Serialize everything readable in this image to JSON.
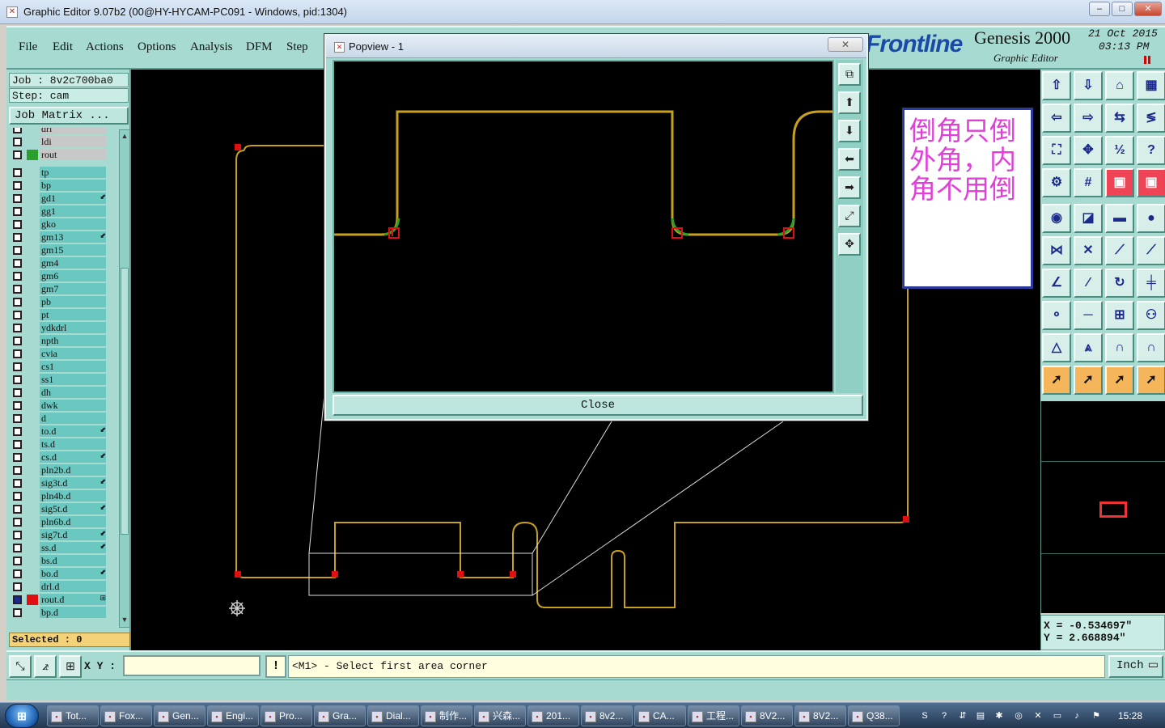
{
  "window": {
    "title": "Graphic Editor 9.07b2 (00@HY-HYCAM-PC091 - Windows, pid:1304)",
    "min": "‒",
    "max": "□",
    "close": "✕"
  },
  "menu": {
    "items": [
      "File",
      "Edit",
      "Actions",
      "Options",
      "Analysis",
      "DFM",
      "Step"
    ]
  },
  "brand": {
    "logo": "Frontline",
    "product": "Genesis 2000",
    "subtitle": "Graphic Editor",
    "date": "21 Oct 2015",
    "time": "03:13 PM",
    "logo_color": "#1a4aa8"
  },
  "job": {
    "job_line": "Job : 8v2c700ba0",
    "step_line": "Step: cam",
    "matrix_button": "Job Matrix ..."
  },
  "layers": [
    {
      "name": "drl",
      "color": "",
      "board": true,
      "flag": ""
    },
    {
      "name": "ldi",
      "color": "",
      "board": true,
      "flag": ""
    },
    {
      "name": "rout",
      "color": "#2aa02a",
      "board": true,
      "flag": ""
    },
    {
      "name": "tp",
      "color": "",
      "board": false,
      "flag": ""
    },
    {
      "name": "bp",
      "color": "",
      "board": false,
      "flag": ""
    },
    {
      "name": "gd1",
      "color": "",
      "board": false,
      "flag": "⬋"
    },
    {
      "name": "gg1",
      "color": "",
      "board": false,
      "flag": ""
    },
    {
      "name": "gko",
      "color": "",
      "board": false,
      "flag": ""
    },
    {
      "name": "gm13",
      "color": "",
      "board": false,
      "flag": "⬋"
    },
    {
      "name": "gm15",
      "color": "",
      "board": false,
      "flag": ""
    },
    {
      "name": "gm4",
      "color": "",
      "board": false,
      "flag": ""
    },
    {
      "name": "gm6",
      "color": "",
      "board": false,
      "flag": ""
    },
    {
      "name": "gm7",
      "color": "",
      "board": false,
      "flag": ""
    },
    {
      "name": "pb",
      "color": "",
      "board": false,
      "flag": ""
    },
    {
      "name": "pt",
      "color": "",
      "board": false,
      "flag": ""
    },
    {
      "name": "ydkdrl",
      "color": "",
      "board": false,
      "flag": ""
    },
    {
      "name": "npth",
      "color": "",
      "board": false,
      "flag": ""
    },
    {
      "name": "cvia",
      "color": "",
      "board": false,
      "flag": ""
    },
    {
      "name": "cs1",
      "color": "",
      "board": false,
      "flag": ""
    },
    {
      "name": "ss1",
      "color": "",
      "board": false,
      "flag": ""
    },
    {
      "name": "dh",
      "color": "",
      "board": false,
      "flag": ""
    },
    {
      "name": "dwk",
      "color": "",
      "board": false,
      "flag": ""
    },
    {
      "name": "d",
      "color": "",
      "board": false,
      "flag": ""
    },
    {
      "name": "to.d",
      "color": "",
      "board": false,
      "flag": "⬋"
    },
    {
      "name": "ts.d",
      "color": "",
      "board": false,
      "flag": ""
    },
    {
      "name": "cs.d",
      "color": "",
      "board": false,
      "flag": "⬋"
    },
    {
      "name": "pln2b.d",
      "color": "",
      "board": false,
      "flag": ""
    },
    {
      "name": "sig3t.d",
      "color": "",
      "board": false,
      "flag": "⬋"
    },
    {
      "name": "pln4b.d",
      "color": "",
      "board": false,
      "flag": ""
    },
    {
      "name": "sig5t.d",
      "color": "",
      "board": false,
      "flag": "⬋"
    },
    {
      "name": "pln6b.d",
      "color": "",
      "board": false,
      "flag": ""
    },
    {
      "name": "sig7t.d",
      "color": "",
      "board": false,
      "flag": "⬋"
    },
    {
      "name": "ss.d",
      "color": "",
      "board": false,
      "flag": "⬋"
    },
    {
      "name": "bs.d",
      "color": "",
      "board": false,
      "flag": ""
    },
    {
      "name": "bo.d",
      "color": "",
      "board": false,
      "flag": "⬋"
    },
    {
      "name": "drl.d",
      "color": "",
      "board": false,
      "flag": ""
    },
    {
      "name": "rout.d",
      "color": "#e01010",
      "board": false,
      "flag": "⊞",
      "checked": true
    },
    {
      "name": "bp.d",
      "color": "",
      "board": false,
      "flag": ""
    }
  ],
  "selected": "Selected : 0",
  "popview": {
    "title": "Popview - 1",
    "close_label": "Close",
    "x_glyph": "✕"
  },
  "annotation": {
    "text": "倒角只倒外角，内角不用倒",
    "color": "#e040d8"
  },
  "coords": {
    "x": "X = -0.534697\"",
    "y": "Y = 2.668894\""
  },
  "status": {
    "xy_label": "X Y :",
    "xy_value": "",
    "warn": "!",
    "prompt": "<M1> - Select first area corner",
    "unit": "Inch"
  },
  "taskbar": {
    "start": "⊞",
    "tasks": [
      "Tot...",
      "Fox...",
      "Gen...",
      "Engi...",
      "Pro...",
      "Gra...",
      "Dial...",
      "制作...",
      "兴森...",
      "201...",
      "8v2...",
      "CA...",
      "工程...",
      "8V2...",
      "8V2...",
      "Q38..."
    ],
    "clock": "15:28"
  },
  "colors": {
    "rout_line": "#c8a020",
    "corner_mark": "#e01010",
    "panel": "#a7dbd1"
  }
}
